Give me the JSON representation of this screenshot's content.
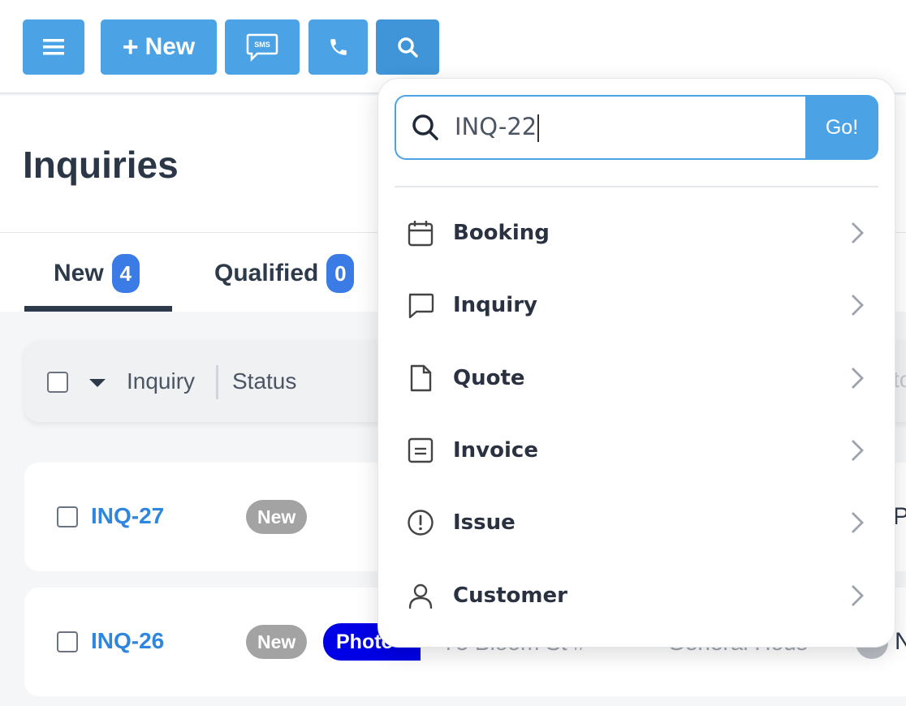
{
  "toolbar": {
    "new_label": "New",
    "sms_label": "SMS"
  },
  "page": {
    "title": "Inquiries"
  },
  "tabs": [
    {
      "label": "New",
      "count": "4"
    },
    {
      "label": "Qualified",
      "count": "0"
    }
  ],
  "table": {
    "columns": [
      "Inquiry",
      "Status"
    ],
    "rows": [
      {
        "id": "INQ-27",
        "status": "New",
        "tag": "",
        "address": "",
        "type": "",
        "edge": "P"
      },
      {
        "id": "INQ-26",
        "status": "New",
        "tag": "Photo",
        "address": "75 Bloom St #",
        "type": "General Hous",
        "edge": "N"
      }
    ],
    "ghost_header_fragment": "to"
  },
  "search": {
    "value": "INQ-22",
    "go_label": "Go!",
    "items": [
      {
        "label": "Booking",
        "icon": "calendar-icon"
      },
      {
        "label": "Inquiry",
        "icon": "chat-bubble-icon"
      },
      {
        "label": "Quote",
        "icon": "document-icon"
      },
      {
        "label": "Invoice",
        "icon": "invoice-icon"
      },
      {
        "label": "Issue",
        "icon": "alert-circle-icon"
      },
      {
        "label": "Customer",
        "icon": "user-icon"
      }
    ]
  },
  "colors": {
    "primary": "#4ba3e6",
    "badge_blue": "#3b7be6",
    "link": "#2f86de",
    "status_gray": "#a3a3a3",
    "photo_tag": "#0000e6"
  }
}
